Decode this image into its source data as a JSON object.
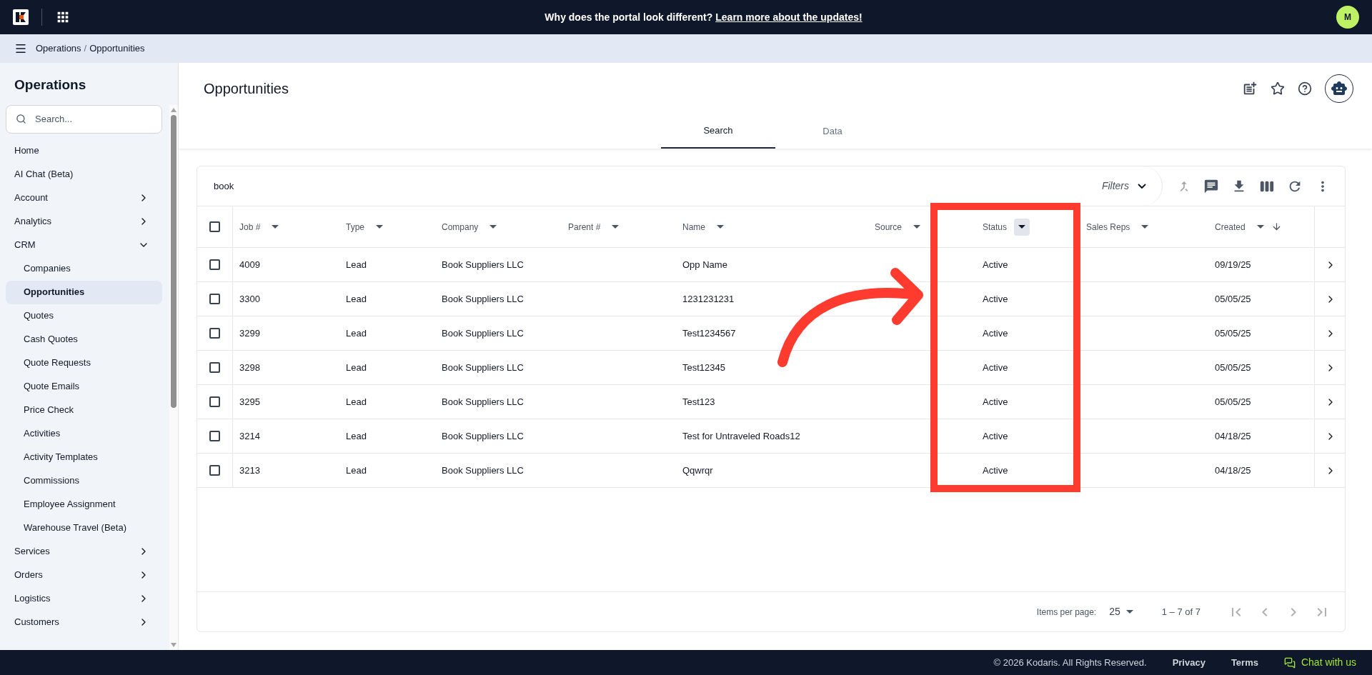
{
  "top_bar": {
    "message": "Why does the portal look different?",
    "link": "Learn more about the updates!",
    "avatar": "M"
  },
  "breadcrumb": {
    "items": [
      "Operations",
      "Opportunities"
    ],
    "separator": "/"
  },
  "sidebar": {
    "title": "Operations",
    "search": {
      "placeholder": "Search..."
    },
    "items": [
      {
        "label": "Home",
        "kind": "link"
      },
      {
        "label": "AI Chat (Beta)",
        "kind": "link"
      },
      {
        "label": "Account",
        "kind": "group",
        "expanded": false
      },
      {
        "label": "Analytics",
        "kind": "group",
        "expanded": false
      },
      {
        "label": "CRM",
        "kind": "group",
        "expanded": true,
        "children": [
          {
            "label": "Companies",
            "selected": false
          },
          {
            "label": "Opportunities",
            "selected": true
          },
          {
            "label": "Quotes",
            "selected": false
          },
          {
            "label": "Cash Quotes",
            "selected": false
          },
          {
            "label": "Quote Requests",
            "selected": false
          },
          {
            "label": "Quote Emails",
            "selected": false
          },
          {
            "label": "Price Check",
            "selected": false
          },
          {
            "label": "Activities",
            "selected": false
          },
          {
            "label": "Activity Templates",
            "selected": false
          },
          {
            "label": "Commissions",
            "selected": false
          },
          {
            "label": "Employee Assignment",
            "selected": false
          },
          {
            "label": "Warehouse Travel (Beta)",
            "selected": false
          }
        ]
      },
      {
        "label": "Services",
        "kind": "group",
        "expanded": false
      },
      {
        "label": "Orders",
        "kind": "group",
        "expanded": false
      },
      {
        "label": "Logistics",
        "kind": "group",
        "expanded": false
      },
      {
        "label": "Customers",
        "kind": "group",
        "expanded": false
      }
    ]
  },
  "page": {
    "title": "Opportunities"
  },
  "tabs": [
    {
      "label": "Search",
      "selected": true
    },
    {
      "label": "Data",
      "selected": false
    }
  ],
  "search_query": "book",
  "filters_label": "Filters",
  "table": {
    "select_all_checked": false,
    "columns": [
      {
        "label": "Job #",
        "filter_active": false,
        "sorted_desc": false
      },
      {
        "label": "Type",
        "filter_active": false,
        "sorted_desc": false
      },
      {
        "label": "Company",
        "filter_active": false,
        "sorted_desc": false
      },
      {
        "label": "Parent #",
        "filter_active": false,
        "sorted_desc": false
      },
      {
        "label": "Name",
        "filter_active": false,
        "sorted_desc": false
      },
      {
        "label": "Source",
        "filter_active": false,
        "sorted_desc": false
      },
      {
        "label": "Status",
        "filter_active": true,
        "sorted_desc": false
      },
      {
        "label": "Sales Reps",
        "filter_active": false,
        "sorted_desc": false
      },
      {
        "label": "Created",
        "filter_active": false,
        "sorted_desc": true
      }
    ],
    "rows": [
      {
        "checked": false,
        "cells": [
          "4009",
          "Lead",
          "Book Suppliers LLC",
          "",
          "Opp Name",
          "",
          "Active",
          "",
          "09/19/25"
        ]
      },
      {
        "checked": false,
        "cells": [
          "3300",
          "Lead",
          "Book Suppliers LLC",
          "",
          "1231231231",
          "",
          "Active",
          "",
          "05/05/25"
        ]
      },
      {
        "checked": false,
        "cells": [
          "3299",
          "Lead",
          "Book Suppliers LLC",
          "",
          "Test1234567",
          "",
          "Active",
          "",
          "05/05/25"
        ]
      },
      {
        "checked": false,
        "cells": [
          "3298",
          "Lead",
          "Book Suppliers LLC",
          "",
          "Test12345",
          "",
          "Active",
          "",
          "05/05/25"
        ]
      },
      {
        "checked": false,
        "cells": [
          "3295",
          "Lead",
          "Book Suppliers LLC",
          "",
          "Test123",
          "",
          "Active",
          "",
          "05/05/25"
        ]
      },
      {
        "checked": false,
        "cells": [
          "3214",
          "Lead",
          "Book Suppliers LLC",
          "",
          "Test for Untraveled Roads12",
          "",
          "Active",
          "",
          "04/18/25"
        ]
      },
      {
        "checked": false,
        "cells": [
          "3213",
          "Lead",
          "Book Suppliers LLC",
          "",
          "Qqwrqr",
          "",
          "Active",
          "",
          "04/18/25"
        ]
      }
    ]
  },
  "pagination": {
    "label": "Items per page:",
    "page_size": "25",
    "range": "1 – 7 of 7",
    "buttons": [
      {
        "kind": "first",
        "disabled": true
      },
      {
        "kind": "prev",
        "disabled": true
      },
      {
        "kind": "next",
        "disabled": true
      },
      {
        "kind": "last",
        "disabled": true
      }
    ]
  },
  "footer": {
    "copyright": "© 2026 Kodaris. All Rights Reserved.",
    "links": [
      "Privacy",
      "Terms"
    ],
    "chat": "Chat with us"
  }
}
